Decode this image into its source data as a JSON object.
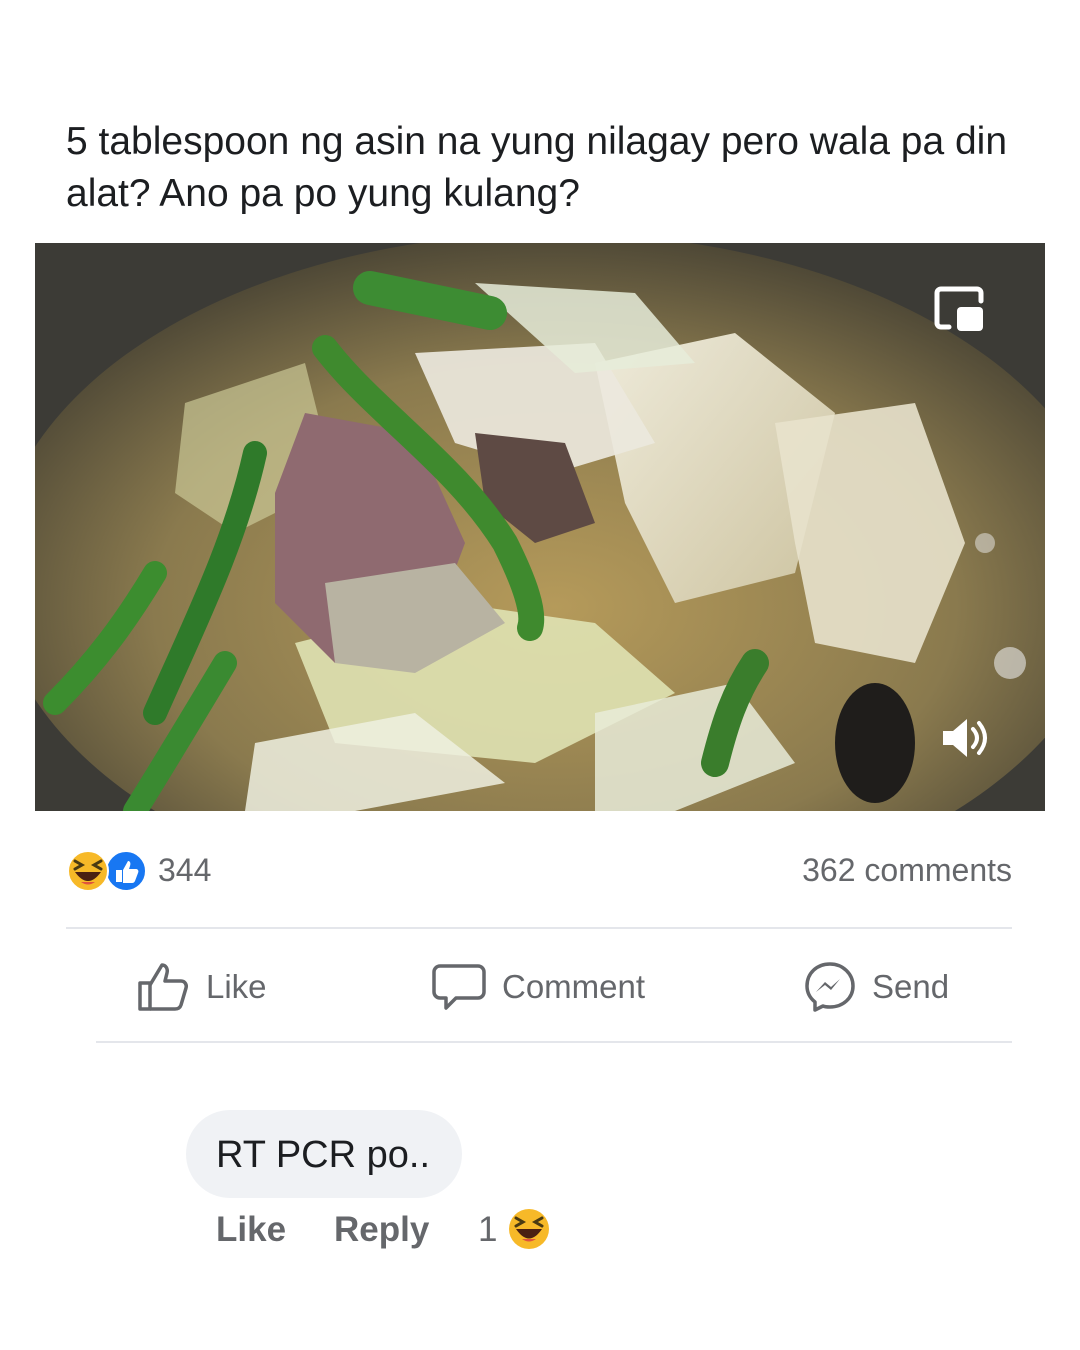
{
  "post": {
    "caption": "5 tablespoon ng asin na yung nilagay pero wala pa din alat? Ano pa po yung kulang?",
    "media": {
      "controls": [
        "picture-in-picture-icon",
        "sound-icon"
      ]
    },
    "reactions": {
      "icons": [
        "haha-reaction-icon",
        "like-reaction-icon"
      ],
      "count": "344"
    },
    "comments_count": "362 comments",
    "actions": {
      "like": "Like",
      "comment": "Comment",
      "send": "Send"
    }
  },
  "comment": {
    "text": "RT PCR po..",
    "actions": {
      "like": "Like",
      "reply": "Reply",
      "reaction_count": "1"
    },
    "reaction_icon": "haha-reaction-icon"
  },
  "colors": {
    "text_primary": "#1c1e21",
    "text_secondary": "#65676b",
    "like_blue": "#1877f2",
    "haha_yellow": "#f7b928",
    "divider": "#e4e6eb",
    "comment_bg": "#f0f2f5"
  }
}
